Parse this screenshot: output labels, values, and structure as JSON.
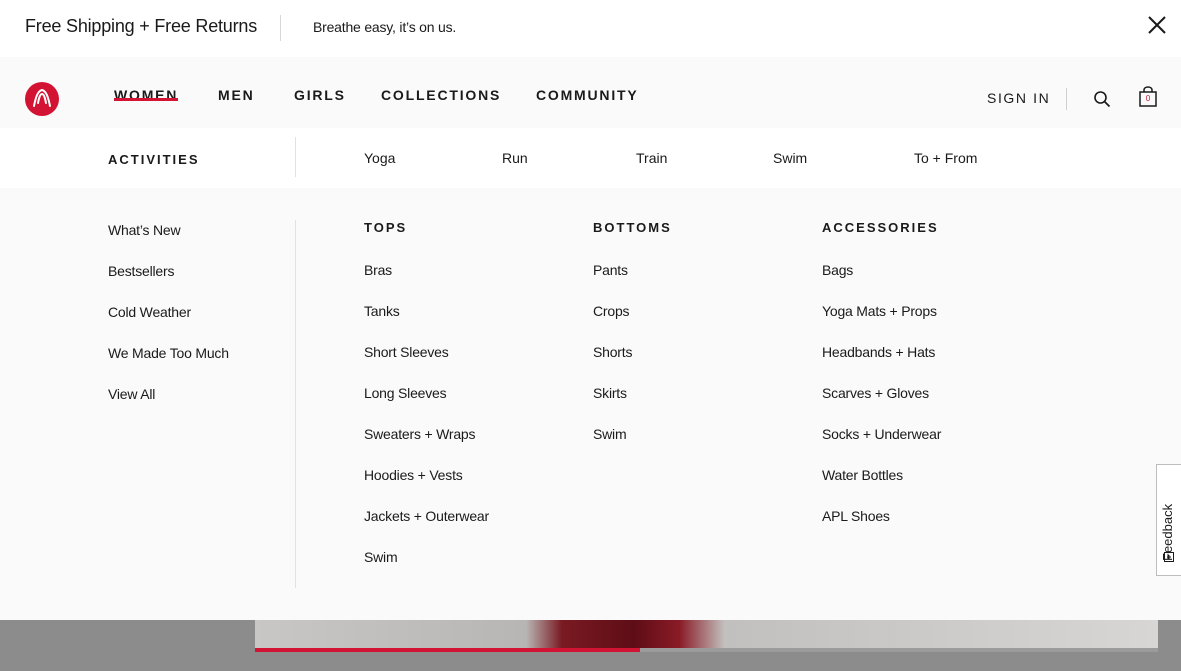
{
  "promo": {
    "title": "Free Shipping + Free Returns",
    "subtitle": "Breathe easy, it’s on us."
  },
  "header": {
    "nav": [
      "WOMEN",
      "MEN",
      "GIRLS",
      "COLLECTIONS",
      "COMMUNITY"
    ],
    "active_nav": "WOMEN",
    "sign_in": "SIGN IN",
    "bag_count": "0"
  },
  "subbar": {
    "label": "ACTIVITIES",
    "activities": [
      "Yoga",
      "Run",
      "Train",
      "Swim",
      "To + From"
    ]
  },
  "menu": {
    "featured": [
      "What’s New",
      "Bestsellers",
      "Cold Weather",
      "We Made Too Much",
      "View All"
    ],
    "tops": {
      "heading": "TOPS",
      "items": [
        "Bras",
        "Tanks",
        "Short Sleeves",
        "Long Sleeves",
        "Sweaters + Wraps",
        "Hoodies + Vests",
        "Jackets + Outerwear",
        "Swim"
      ]
    },
    "bottoms": {
      "heading": "BOTTOMS",
      "items": [
        "Pants",
        "Crops",
        "Shorts",
        "Skirts",
        "Swim"
      ]
    },
    "accessories": {
      "heading": "ACCESSORIES",
      "items": [
        "Bags",
        "Yoga Mats + Props",
        "Headbands + Hats",
        "Scarves + Gloves",
        "Socks + Underwear",
        "Water Bottles",
        "APL Shoes"
      ]
    }
  },
  "feedback": {
    "label": "Feedback"
  },
  "hero": {
    "progress": 0.426
  },
  "colors": {
    "brand_red": "#d31334",
    "menu_bg": "#fafafa",
    "text": "#1a1a1a"
  },
  "icons": [
    "close-icon",
    "lululemon-logo-icon",
    "search-icon",
    "shopping-bag-icon",
    "feedback-icon"
  ]
}
